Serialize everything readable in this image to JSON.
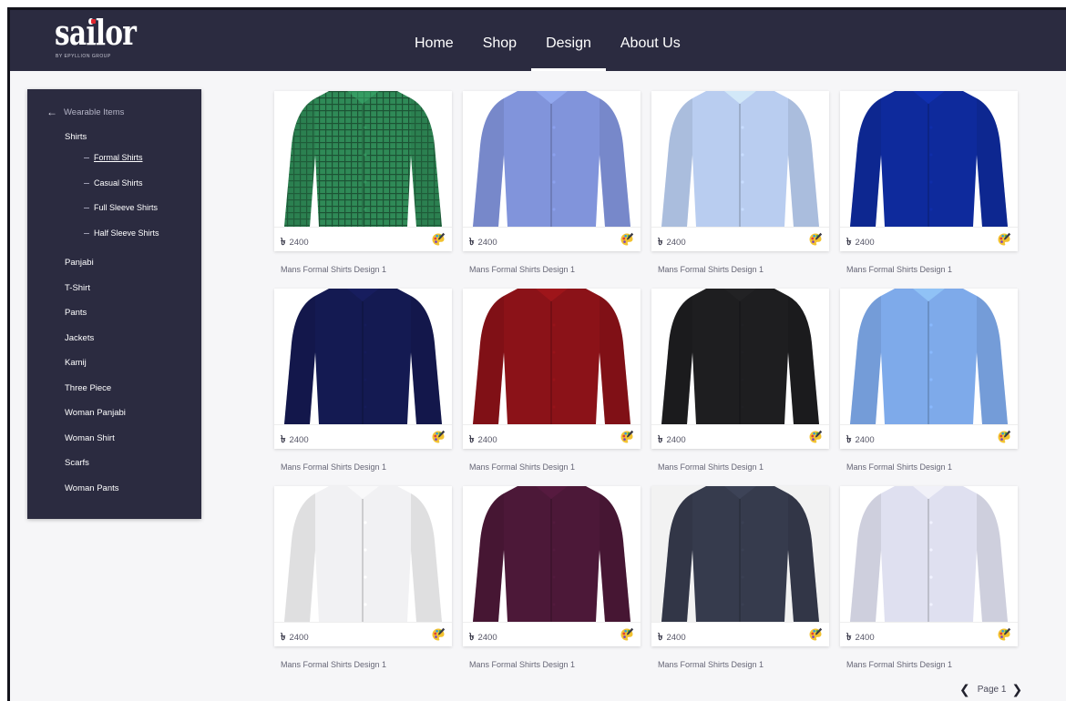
{
  "brand": {
    "logo_text": "sailor",
    "tagline": "BY EPYLLION GROUP"
  },
  "nav": {
    "items": [
      {
        "label": "Home",
        "active": false
      },
      {
        "label": "Shop",
        "active": false
      },
      {
        "label": "Design",
        "active": true
      },
      {
        "label": "About Us",
        "active": false
      }
    ]
  },
  "sidebar": {
    "back_label": "Wearable Items",
    "back_icon": "arrow-left-icon",
    "category": "Shirts",
    "subcategories": [
      {
        "label": "Formal Shirts",
        "selected": true
      },
      {
        "label": "Casual Shirts",
        "selected": false
      },
      {
        "label": "Full Sleeve Shirts",
        "selected": false
      },
      {
        "label": "Half Sleeve Shirts",
        "selected": false
      }
    ],
    "items": [
      "Panjabi",
      "T-Shirt",
      "Pants",
      "Jackets",
      "Kamij",
      "Three Piece",
      "Woman Panjabi",
      "Woman Shirt",
      "Scarfs",
      "Woman Pants"
    ]
  },
  "products": [
    {
      "title": "Mans Formal Shirts Design 1",
      "price": "2400",
      "currency": "৳",
      "color": "#2f8a57",
      "pattern": "check",
      "bg": "#ffffff"
    },
    {
      "title": "Mans Formal Shirts Design 1",
      "price": "2400",
      "currency": "৳",
      "color": "#8194db",
      "pattern": "plain",
      "bg": "#ffffff"
    },
    {
      "title": "Mans Formal Shirts Design 1",
      "price": "2400",
      "currency": "৳",
      "color": "#b9cdf0",
      "pattern": "plain",
      "bg": "#ffffff"
    },
    {
      "title": "Mans Formal Shirts Design 1",
      "price": "2400",
      "currency": "৳",
      "color": "#0e2a9c",
      "pattern": "plain",
      "bg": "#ffffff"
    },
    {
      "title": "Mans Formal Shirts Design 1",
      "price": "2400",
      "currency": "৳",
      "color": "#141a52",
      "pattern": "plain",
      "bg": "#ffffff"
    },
    {
      "title": "Mans Formal Shirts Design 1",
      "price": "2400",
      "currency": "৳",
      "color": "#8b1218",
      "pattern": "plain",
      "bg": "#ffffff"
    },
    {
      "title": "Mans Formal Shirts Design 1",
      "price": "2400",
      "currency": "৳",
      "color": "#1e1e20",
      "pattern": "plain",
      "bg": "#ffffff"
    },
    {
      "title": "Mans Formal Shirts Design 1",
      "price": "2400",
      "currency": "৳",
      "color": "#7eaaea",
      "pattern": "plain",
      "bg": "#ffffff"
    },
    {
      "title": "Mans Formal Shirts Design 1",
      "price": "2400",
      "currency": "৳",
      "color": "#f1f1f3",
      "pattern": "plain",
      "bg": "#ffffff"
    },
    {
      "title": "Mans Formal Shirts Design 1",
      "price": "2400",
      "currency": "৳",
      "color": "#4c1838",
      "pattern": "plain",
      "bg": "#ffffff"
    },
    {
      "title": "Mans Formal Shirts Design 1",
      "price": "2400",
      "currency": "৳",
      "color": "#363b4d",
      "pattern": "plain",
      "bg": "#f2f2f2"
    },
    {
      "title": "Mans Formal Shirts Design 1",
      "price": "2400",
      "currency": "৳",
      "color": "#dfe0f0",
      "pattern": "plain",
      "bg": "#ffffff"
    }
  ],
  "pager": {
    "label": "Page 1",
    "prev_icon": "chevron-left-icon",
    "next_icon": "chevron-right-icon"
  },
  "colors": {
    "header_bg": "#2b2b40",
    "page_bg": "#f6f6f8",
    "accent": "#ffffff"
  }
}
